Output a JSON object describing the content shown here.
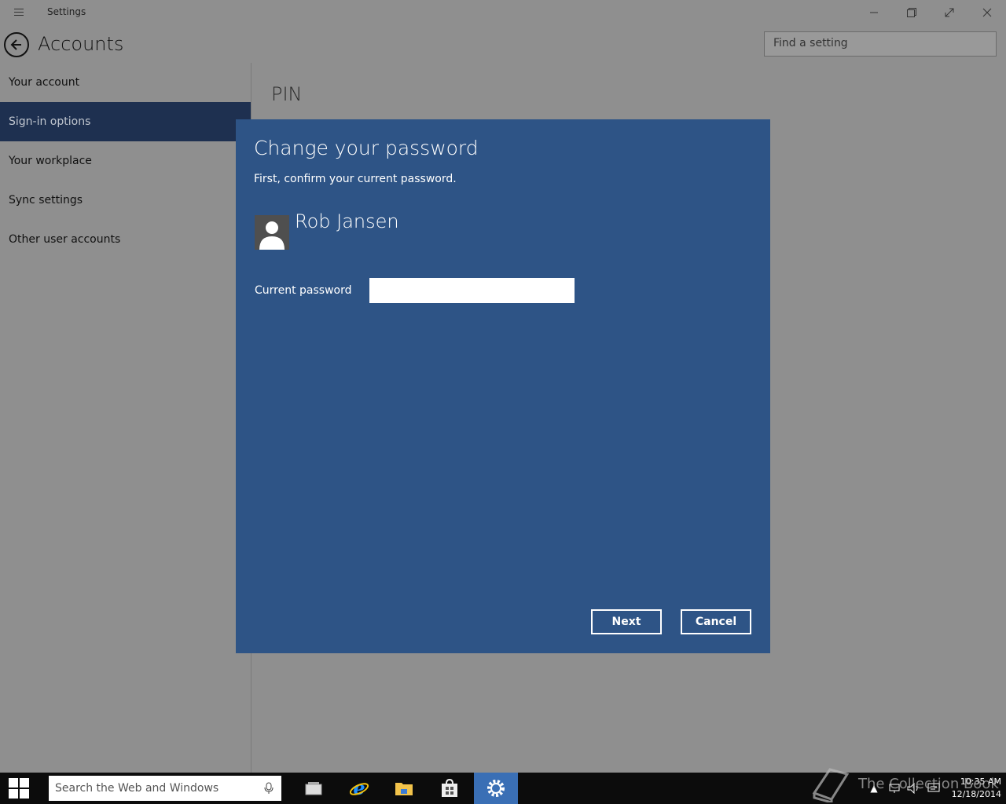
{
  "window": {
    "title": "Settings"
  },
  "header": {
    "title": "Accounts",
    "search_placeholder": "Find a setting"
  },
  "nav": {
    "items": [
      {
        "label": "Your account"
      },
      {
        "label": "Sign-in options",
        "selected": true
      },
      {
        "label": "Your workplace"
      },
      {
        "label": "Sync settings"
      },
      {
        "label": "Other user accounts"
      }
    ]
  },
  "content": {
    "section_title": "PIN"
  },
  "dialog": {
    "title": "Change your password",
    "subtitle": "First, confirm your current password.",
    "user_name": "Rob Jansen",
    "password_label": "Current password",
    "password_value": "",
    "next_label": "Next",
    "cancel_label": "Cancel"
  },
  "taskbar": {
    "search_placeholder": "Search the Web and Windows",
    "time": "10:35 AM",
    "date": "12/18/2014"
  },
  "watermark": {
    "text": "The Collection Book"
  },
  "colors": {
    "dialog_bg": "#2e5486",
    "nav_selected": "#1e3050",
    "background": "#8f8f8f",
    "taskbar": "#0c0c0c",
    "active_app": "#3a6fb5"
  }
}
